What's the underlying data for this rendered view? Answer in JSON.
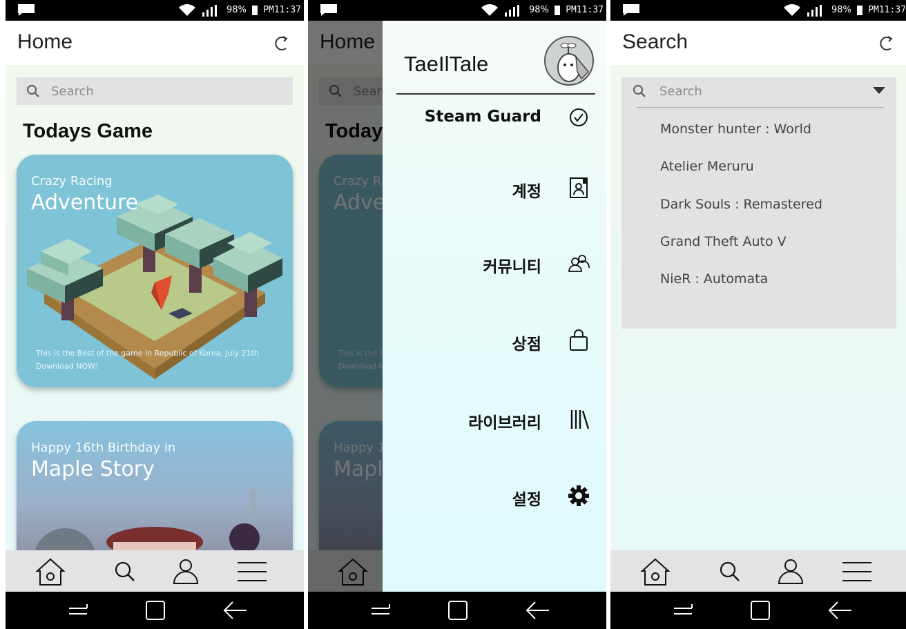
{
  "status": {
    "battery": "98%",
    "time": "PM11:37"
  },
  "home": {
    "title": "Home",
    "search_placeholder": "Search",
    "section_title": "Todays Game",
    "cards": [
      {
        "subtitle": "Crazy Racing",
        "title": "Adventure",
        "footer_line1": "This is the Best of the game in Republic of Korea, July 21th",
        "footer_line2": "Download NOW!"
      },
      {
        "subtitle": "Happy 16th Birthday in",
        "title": "Maple Story"
      }
    ]
  },
  "drawer": {
    "title": "TaeIlTale",
    "items": [
      {
        "label": "Steam Guard",
        "icon": "check-circle-icon"
      },
      {
        "label": "계정",
        "icon": "contact-book-icon"
      },
      {
        "label": "커뮤니티",
        "icon": "people-icon"
      },
      {
        "label": "상점",
        "icon": "shopping-bag-icon"
      },
      {
        "label": "라이브러리",
        "icon": "library-icon"
      },
      {
        "label": "설정",
        "icon": "gear-icon"
      }
    ]
  },
  "search": {
    "title": "Search",
    "placeholder": "Search",
    "options": [
      "Monster hunter : World",
      "Atelier Meruru",
      "Dark Souls : Remastered",
      "Grand Theft Auto V",
      "NieR : Automata"
    ]
  },
  "bottom_nav": [
    "home-icon",
    "search-icon",
    "profile-icon",
    "menu-icon"
  ],
  "colors": {
    "searchbar": "#e2e2e2",
    "card1": "#7ec3d6",
    "navbar": "#e3e3e3"
  }
}
